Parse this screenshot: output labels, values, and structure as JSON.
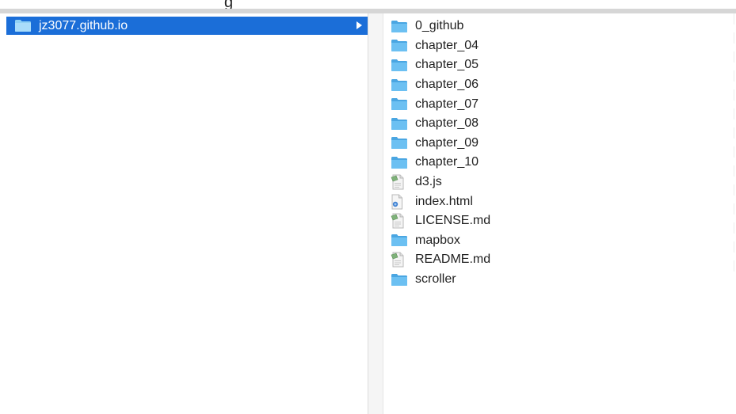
{
  "window": {
    "partial_title": "g"
  },
  "left_column": {
    "selected_item": {
      "label": "jz3077.github.io",
      "icon": "folder-icon"
    }
  },
  "right_column": {
    "items": [
      {
        "label": "0_github",
        "icon": "folder-icon"
      },
      {
        "label": "chapter_04",
        "icon": "folder-icon"
      },
      {
        "label": "chapter_05",
        "icon": "folder-icon"
      },
      {
        "label": "chapter_06",
        "icon": "folder-icon"
      },
      {
        "label": "chapter_07",
        "icon": "folder-icon"
      },
      {
        "label": "chapter_08",
        "icon": "folder-icon"
      },
      {
        "label": "chapter_09",
        "icon": "folder-icon"
      },
      {
        "label": "chapter_10",
        "icon": "folder-icon"
      },
      {
        "label": "d3.js",
        "icon": "document-icon"
      },
      {
        "label": "index.html",
        "icon": "html-file-icon"
      },
      {
        "label": "LICENSE.md",
        "icon": "document-icon"
      },
      {
        "label": "mapbox",
        "icon": "folder-icon"
      },
      {
        "label": "README.md",
        "icon": "document-icon"
      },
      {
        "label": "scroller",
        "icon": "folder-icon"
      }
    ]
  },
  "colors": {
    "selection": "#1b6ed8",
    "folder": "#5fb7ec",
    "text": "#222222"
  }
}
